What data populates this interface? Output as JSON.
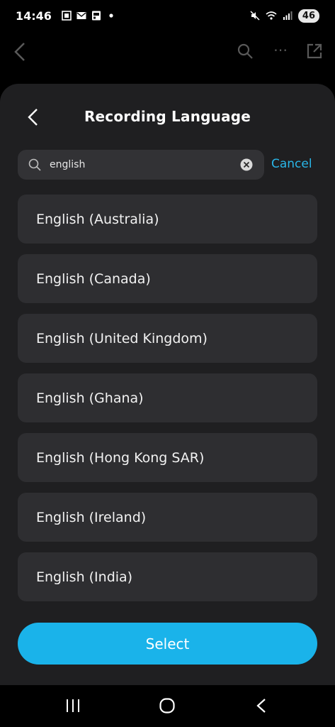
{
  "status_bar": {
    "time": "14:46",
    "battery": "46",
    "icons": [
      "screenshot-icon",
      "mail-icon",
      "app-icon",
      "dot-icon",
      "mute-icon",
      "wifi-icon",
      "signal-icon"
    ]
  },
  "background_app": {
    "icons": [
      "back-arrow-icon",
      "search-icon",
      "more-icon",
      "share-icon"
    ]
  },
  "sheet": {
    "title": "Recording Language",
    "search": {
      "value": "english",
      "placeholder": "",
      "cancel_label": "Cancel"
    },
    "languages": [
      "English (Australia)",
      "English (Canada)",
      "English (United Kingdom)",
      "English (Ghana)",
      "English (Hong Kong SAR)",
      "English (Ireland)",
      "English (India)"
    ],
    "select_label": "Select"
  },
  "colors": {
    "accent": "#1ab3ea",
    "sheet_bg": "#1f1f21",
    "item_bg": "#2e2e31"
  }
}
